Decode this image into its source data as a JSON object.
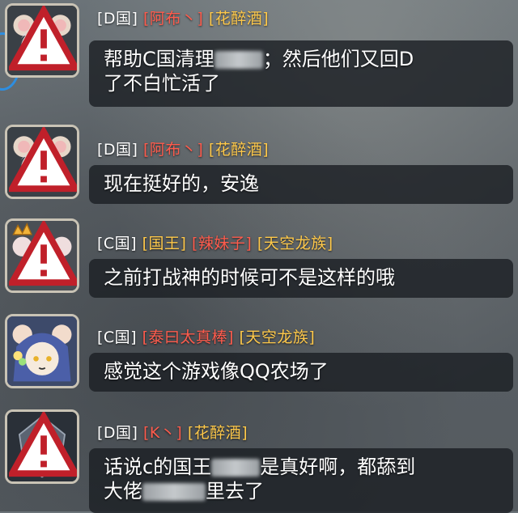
{
  "messages": [
    {
      "server": "[D国]",
      "name": "[阿布丶]",
      "guild": "[花醉酒]",
      "text_a": "帮助C国清理",
      "text_b": "；然后他们又回D",
      "text_c": "了不白忙活了"
    },
    {
      "server": "[D国]",
      "name": "[阿布丶]",
      "guild": "[花醉酒]",
      "text": "现在挺好的，安逸"
    },
    {
      "server": "[C国]",
      "title": "[国王]",
      "name": "[辣妹子]",
      "guild": "[天空龙族]",
      "text": "之前打战神的时候可不是这样的哦"
    },
    {
      "server": "[C国]",
      "name": "[泰曰太真棒]",
      "guild": "[天空龙族]",
      "text": "感觉这个游戏像QQ农场了"
    },
    {
      "server": "[D国]",
      "name": "[K丶]",
      "guild": "[花醉酒]",
      "text_a": "话说c的国王",
      "text_b": "是真好啊，都舔到",
      "text_c": "大佬",
      "text_d": "里去了"
    }
  ],
  "colors": {
    "name_red": "#ff5c4d",
    "tag_gold": "#ffc94a",
    "bubble_bg": "rgba(28,32,36,0.82)"
  },
  "icons": {
    "avatar_1": "mouse-sage-avatar-icon",
    "avatar_2": "mouse-sage-avatar-icon",
    "avatar_3": "crowned-mouse-girl-avatar-icon",
    "avatar_4": "flower-mouse-girl-avatar-icon",
    "avatar_5": "armored-warrior-avatar-icon",
    "warning": "warning-triangle-icon"
  }
}
